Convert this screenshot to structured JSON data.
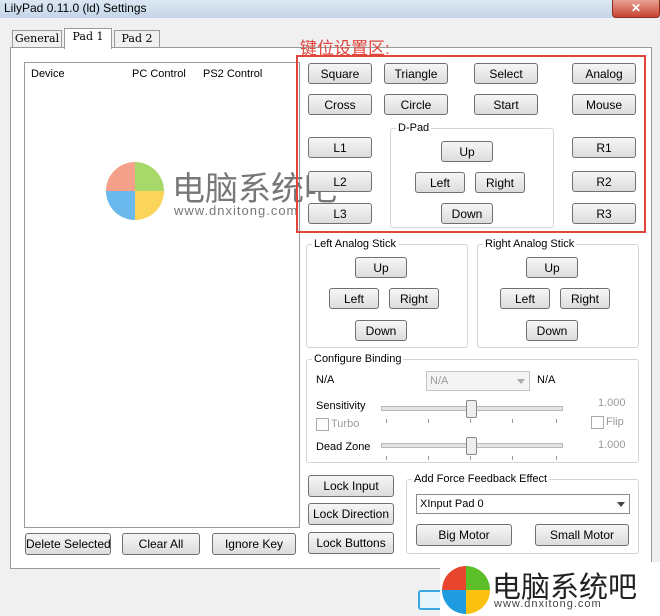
{
  "window": {
    "title": "LilyPad 0.11.0 (ld) Settings",
    "close_symbol": "✕"
  },
  "tabs": [
    {
      "label": "General"
    },
    {
      "label": "Pad 1"
    },
    {
      "label": "Pad 2"
    }
  ],
  "device_list": {
    "columns": [
      "Device",
      "PC Control",
      "PS2 Control"
    ]
  },
  "annotation": "键位设置区:",
  "buttons_main": {
    "square": "Square",
    "triangle": "Triangle",
    "select": "Select",
    "analog": "Analog",
    "cross": "Cross",
    "circle": "Circle",
    "start": "Start",
    "mouse": "Mouse",
    "l1": "L1",
    "l2": "L2",
    "l3": "L3",
    "r1": "R1",
    "r2": "R2",
    "r3": "R3"
  },
  "dpad": {
    "label": "D-Pad",
    "up": "Up",
    "left": "Left",
    "right": "Right",
    "down": "Down"
  },
  "left_stick": {
    "label": "Left Analog Stick",
    "up": "Up",
    "left": "Left",
    "right": "Right",
    "down": "Down"
  },
  "right_stick": {
    "label": "Right Analog Stick",
    "up": "Up",
    "left": "Left",
    "right": "Right",
    "down": "Down"
  },
  "configure": {
    "label": "Configure Binding",
    "na_left": "N/A",
    "combo_value": "N/A",
    "na_right": "N/A",
    "sensitivity_label": "Sensitivity",
    "sensitivity_value": "1.000",
    "sensitivity_level": 0.5,
    "turbo_label": "Turbo",
    "flip_label": "Flip",
    "deadzone_label": "Dead Zone",
    "deadzone_value": "1.000",
    "deadzone_level": 0.5
  },
  "lock": {
    "input": "Lock Input",
    "direction": "Lock Direction",
    "buttons": "Lock Buttons"
  },
  "force_feedback": {
    "label": "Add Force Feedback Effect",
    "device": "XInput Pad 0",
    "big_motor": "Big Motor",
    "small_motor": "Small Motor"
  },
  "bottom": {
    "delete_selected": "Delete Selected",
    "clear_all": "Clear All",
    "ignore_key": "Ignore Key"
  },
  "watermark": {
    "name": "电脑系统吧",
    "url": "www.dnxitong.com"
  },
  "colors": {
    "annotation_red": "#e0463c",
    "wm_red": "#f4a08a",
    "wm_green": "#a8d86a",
    "wm_blue": "#6ab8ec",
    "wm_yellow": "#fbd45a"
  }
}
